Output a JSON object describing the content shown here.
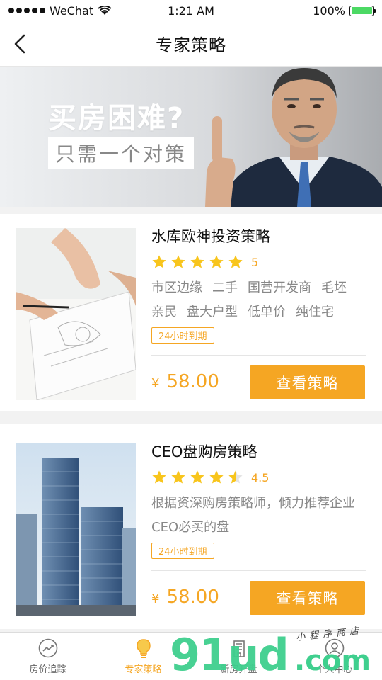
{
  "status_bar": {
    "carrier": "WeChat",
    "time": "1:21 AM",
    "battery": "100%"
  },
  "nav": {
    "title": "专家策略"
  },
  "banner": {
    "headline": "买房困难?",
    "subheadline": "只需一个对策"
  },
  "products": [
    {
      "title": "水库欧神投资策略",
      "rating": 5,
      "rating_label": "5",
      "tags": [
        "市区边缘",
        "二手",
        "国营开发商",
        "毛坯",
        "亲民",
        "盘大户型",
        "低单价",
        "纯住宅"
      ],
      "expiry": "24小时到期",
      "currency": "¥",
      "price": "58.00",
      "button": "查看策略"
    },
    {
      "title": "CEO盘购房策略",
      "rating": 4.5,
      "rating_label": "4.5",
      "description": "根据资深购房策略师，倾力推荐企业CEO必买的盘",
      "expiry": "24小时到期",
      "currency": "¥",
      "price": "58.00",
      "button": "查看策略"
    }
  ],
  "tab_bar": [
    {
      "label": "房价追踪",
      "icon": "trend-chart-icon",
      "active": false
    },
    {
      "label": "专家策略",
      "icon": "lightbulb-icon",
      "active": true
    },
    {
      "label": "新房开盘",
      "icon": "building-icon",
      "active": false
    },
    {
      "label": "个人中心",
      "icon": "user-icon",
      "active": false
    }
  ],
  "watermark": {
    "main": "91ud",
    "domain": ".com",
    "caption": "小程序商店"
  },
  "colors": {
    "accent": "#f5a623",
    "battery": "#4cd964",
    "watermark": "#3fcf8e"
  }
}
